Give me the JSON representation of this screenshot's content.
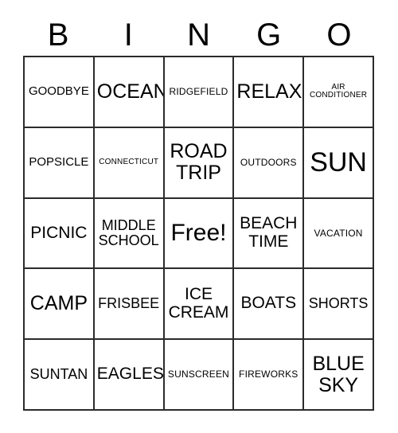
{
  "header": {
    "letters": [
      {
        "label": "B"
      },
      {
        "label": "I"
      },
      {
        "label": "N"
      },
      {
        "label": "G"
      },
      {
        "label": "O"
      }
    ]
  },
  "grid": {
    "rows": 5,
    "columns": 5,
    "border_color": "#2b2b2b",
    "background_color": "#ffffff",
    "text_color": "#000000",
    "cells": [
      {
        "text": "GOODBYE",
        "size": "sz-m",
        "name": "bingo-cell-b1"
      },
      {
        "text": "OCEAN",
        "size": "sz-xxl",
        "name": "bingo-cell-i1"
      },
      {
        "text": "RIDGEFIELD",
        "size": "sz-s",
        "name": "bingo-cell-n1"
      },
      {
        "text": "RELAX",
        "size": "sz-xxl",
        "name": "bingo-cell-g1"
      },
      {
        "text": "AIR\nCONDITIONER",
        "size": "sz-xs",
        "name": "bingo-cell-o1"
      },
      {
        "text": "POPSICLE",
        "size": "sz-m",
        "name": "bingo-cell-b2"
      },
      {
        "text": "CONNECTICUT",
        "size": "sz-xs",
        "name": "bingo-cell-i2"
      },
      {
        "text": "ROAD\nTRIP",
        "size": "sz-xxl",
        "name": "bingo-cell-n2"
      },
      {
        "text": "OUTDOORS",
        "size": "sz-s",
        "name": "bingo-cell-g2"
      },
      {
        "text": "SUN",
        "size": "sz-mega",
        "name": "bingo-cell-o2"
      },
      {
        "text": "PICNIC",
        "size": "sz-xl",
        "name": "bingo-cell-b3"
      },
      {
        "text": "MIDDLE\nSCHOOL",
        "size": "sz-l",
        "name": "bingo-cell-i3"
      },
      {
        "text": "Free!",
        "size": "sz-huge",
        "name": "bingo-cell-free-space"
      },
      {
        "text": "BEACH\nTIME",
        "size": "sz-xl",
        "name": "bingo-cell-g3"
      },
      {
        "text": "VACATION",
        "size": "sz-s",
        "name": "bingo-cell-o3"
      },
      {
        "text": "CAMP",
        "size": "sz-xxl",
        "name": "bingo-cell-b4"
      },
      {
        "text": "FRISBEE",
        "size": "sz-l",
        "name": "bingo-cell-i4"
      },
      {
        "text": "ICE\nCREAM",
        "size": "sz-xl",
        "name": "bingo-cell-n4"
      },
      {
        "text": "BOATS",
        "size": "sz-xl",
        "name": "bingo-cell-g4"
      },
      {
        "text": "SHORTS",
        "size": "sz-l",
        "name": "bingo-cell-o4"
      },
      {
        "text": "SUNTAN",
        "size": "sz-l",
        "name": "bingo-cell-b5"
      },
      {
        "text": "EAGLES",
        "size": "sz-xl",
        "name": "bingo-cell-i5"
      },
      {
        "text": "SUNSCREEN",
        "size": "sz-s",
        "name": "bingo-cell-n5"
      },
      {
        "text": "FIREWORKS",
        "size": "sz-s",
        "name": "bingo-cell-g5"
      },
      {
        "text": "BLUE\nSKY",
        "size": "sz-xxl",
        "name": "bingo-cell-o5"
      }
    ]
  }
}
